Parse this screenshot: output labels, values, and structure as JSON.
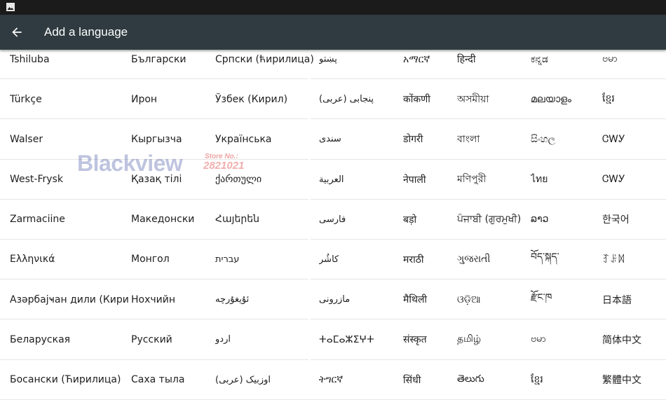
{
  "status_bar": {
    "icon": "image-icon"
  },
  "app_bar": {
    "title": "Add a language",
    "back_icon": "arrow-back-icon"
  },
  "columns": [
    [
      "Tshiluba",
      "Türkçe",
      "Walser",
      "West-Frysk",
      "Zarmaciine",
      "Ελληνικά",
      "Азәрбајҹан дили (Кирил",
      "Беларуская",
      "Босански (Ћирилица)"
    ],
    [
      "Български",
      "Ирон",
      "Кыргызча",
      "Қазақ тілі",
      "Македонски",
      "Монгол",
      "Нохчийн",
      "Русский",
      "Саха тыла"
    ],
    [
      "Српски (ћирилица)",
      "Ўзбек (Кирил)",
      "Українська",
      "ქართული",
      "Հայերեն",
      "עברית",
      "ئۇيغۇرچە",
      "اردو",
      "اوزبیک (عربی)"
    ],
    [
      "پښتو",
      "پنجابی (عربی)",
      "سندی",
      "العربية",
      "فارسی",
      "کاشُر",
      "مازرونی",
      "ⵜⴰⵎⴰⵣⵉⵖⵜ",
      "ትግርኛ"
    ],
    [
      "አማርኛ",
      "कोंकणी",
      "डोगरी",
      "नेपाली",
      "बड़ो",
      "मराठी",
      "मैथिली",
      "संस्कृत",
      "सिंधी"
    ],
    [
      "हिन्दी",
      "অসমীয়া",
      "বাংলা",
      "মণিপুরী",
      "ਪੰਜਾਬੀ (ਗੁਰਮੁਖੀ)",
      "ગુજરાતી",
      "ଓଡ଼ିଆ",
      "தமிழ்",
      "తెలుగు"
    ],
    [
      "ಕನ್ನಡ",
      "മലയാളം",
      "සිංහල",
      "ไทย",
      "ລາວ",
      "བོད་སྐད་",
      "རྫོང་ཁ",
      "ဗမာ",
      "ខ្មែរ"
    ],
    [
      "ဗမာ",
      "ខ្មែរ",
      "ᏣᎳᎩ",
      "ᏣᎳᎩ",
      "한국어",
      "ꆈꌠꉙ",
      "日本語",
      "简体中文",
      "繁體中文"
    ]
  ],
  "watermark": {
    "brand": "Blackview",
    "store_label": "Store No.:",
    "store_number": "2821021"
  }
}
